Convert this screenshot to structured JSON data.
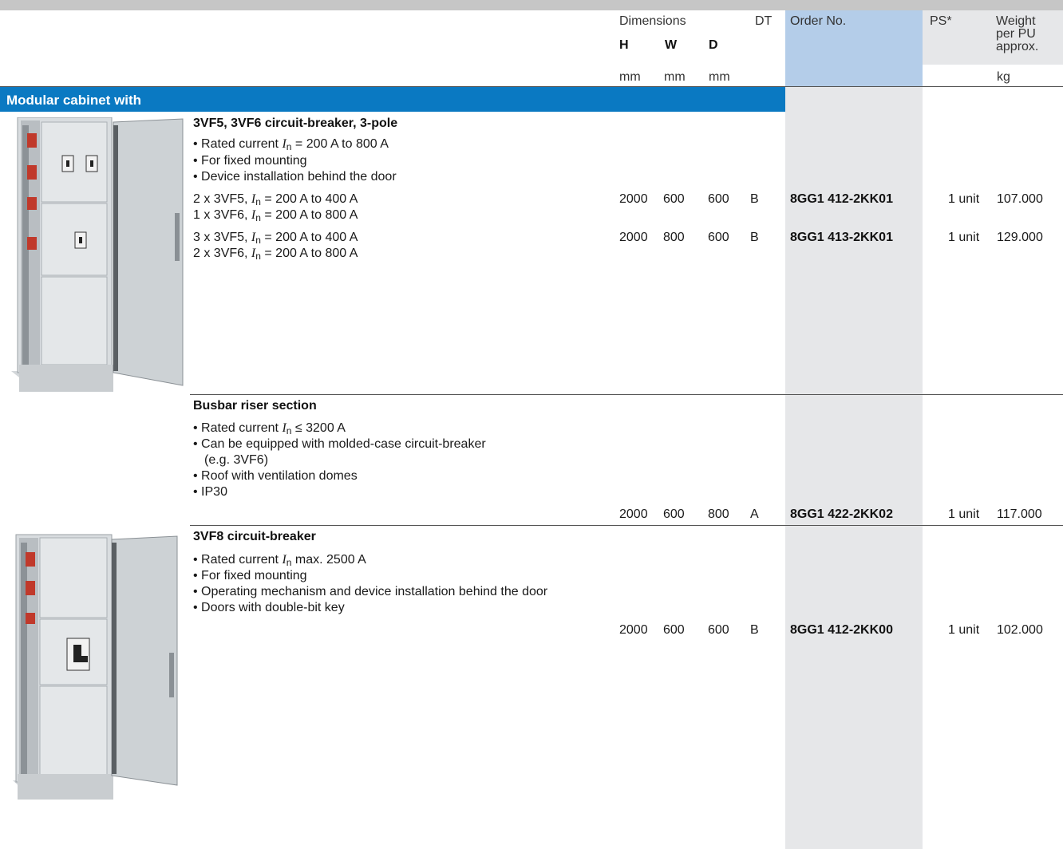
{
  "header": {
    "dimensions": "Dimensions",
    "h": "H",
    "w": "W",
    "d": "D",
    "dt": "DT",
    "order_no": "Order No.",
    "ps": "PS*",
    "weight_1": "Weight",
    "weight_2": "per PU",
    "weight_3": "approx.",
    "mm": "mm",
    "kg": "kg"
  },
  "section_title": "Modular cabinet with",
  "groups": [
    {
      "title": "3VF5, 3VF6 circuit-breaker, 3-pole",
      "bullets": [
        "• Rated current In = 200 A to 800 A",
        "• For fixed mounting",
        "• Device installation behind the door"
      ],
      "rows": [
        {
          "line1": "2 x 3VF5, In = 200 A to 400 A",
          "line2": "1 x 3VF6, In = 200 A to 800 A",
          "h": "2000",
          "w": "600",
          "d": "600",
          "dt": "B",
          "order": "8GG1 412-2KK01",
          "ps": "1 unit",
          "weight": "107.000"
        },
        {
          "line1": "3 x 3VF5, In = 200 A to 400 A",
          "line2": "2 x 3VF6, In = 200 A to 800 A",
          "h": "2000",
          "w": "800",
          "d": "600",
          "dt": "B",
          "order": "8GG1 413-2KK01",
          "ps": "1 unit",
          "weight": "129.000"
        }
      ]
    },
    {
      "title": "Busbar riser section",
      "bullets": [
        "• Rated current In ≤ 3200 A",
        "• Can be equipped with molded-case circuit-breaker",
        "(e.g. 3VF6)",
        "• Roof with ventilation domes",
        "• IP30"
      ],
      "rows": [
        {
          "h": "2000",
          "w": "600",
          "d": "800",
          "dt": "A",
          "order": "8GG1 422-2KK02",
          "ps": "1 unit",
          "weight": "117.000"
        }
      ]
    },
    {
      "title": "3VF8 circuit-breaker",
      "bullets": [
        "• Rated current In max. 2500 A",
        "• For fixed mounting",
        "• Operating mechanism and device installation behind the door",
        "• Doors with double-bit key"
      ],
      "rows": [
        {
          "h": "2000",
          "w": "600",
          "d": "600",
          "dt": "B",
          "order": "8GG1 412-2KK00",
          "ps": "1 unit",
          "weight": "102.000"
        }
      ]
    }
  ],
  "colors": {
    "band": "#0a79c2",
    "order_header": "#b4cde9",
    "column_shade": "#e6e7e9"
  },
  "images": [
    "cabinet-open-door-photo",
    "cabinet-3vf8-photo"
  ]
}
